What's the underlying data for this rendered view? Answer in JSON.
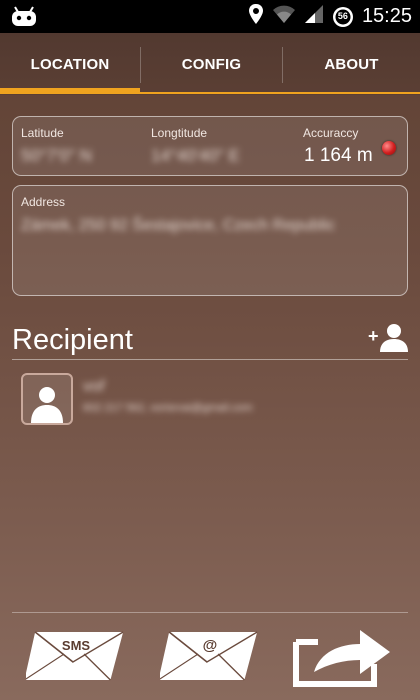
{
  "status_bar": {
    "time": "15:25",
    "battery_level": "56"
  },
  "tabs": [
    {
      "label": "LOCATION",
      "selected": true
    },
    {
      "label": "CONFIG",
      "selected": false
    },
    {
      "label": "ABOUT",
      "selected": false
    }
  ],
  "location": {
    "latitude_label": "Latitude",
    "latitude_value": "50°7'0\" N",
    "longitude_label": "Longtitude",
    "longitude_value": "14°40'40\" E",
    "accuracy_label": "Accuraccy",
    "accuracy_value": "1 164 m",
    "accuracy_status_color": "#d11e1e",
    "address_label": "Address",
    "address_value": "Zámek, 250 92 Šestajovice, Czech Republic"
  },
  "recipient": {
    "title": "Recipient",
    "contact_name": "voř",
    "contact_detail": "602 217 562, vorisrvai@gmail.com"
  },
  "actions": {
    "sms_label": "SMS",
    "email_label": "@"
  },
  "colors": {
    "accent": "#f0a31f"
  },
  "icons": [
    "android-icon",
    "location-pin-icon",
    "wifi-icon",
    "signal-icon",
    "battery-icon",
    "add-recipient-icon",
    "contact-avatar-icon",
    "sms-envelope-icon",
    "email-envelope-icon",
    "share-icon"
  ]
}
